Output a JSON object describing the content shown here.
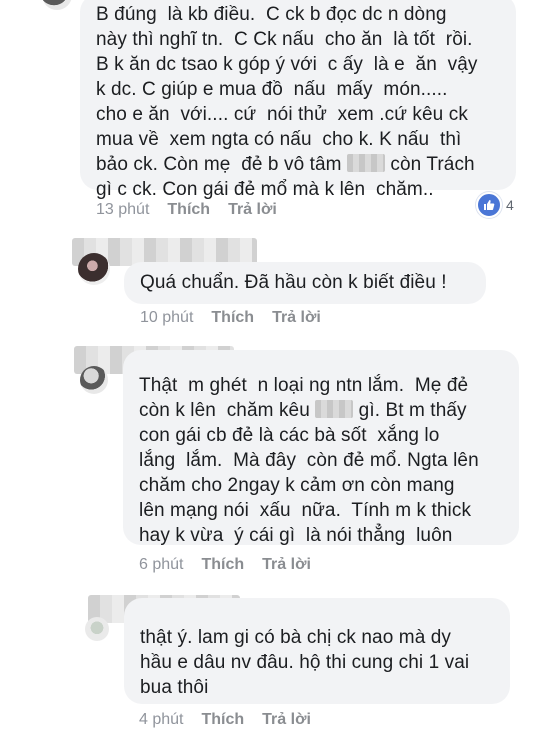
{
  "comments": [
    {
      "lines": [
        "B đúng  là kb điều.  C ck b đọc dc n dòng",
        "này thì nghĩ tn.  C Ck nấu  cho ăn  là tốt  rồi.",
        "B k ăn dc tsao k góp ý với  c ấy  là e  ăn  vậy",
        "k dc. C giúp e mua đồ  nấu  mấy  món.....",
        "cho e ăn  với.... cứ  nói thử  xem .cứ kêu ck",
        "mua về  xem ngta có nấu  cho k. K nấu  thì",
        "bảo ck. Còn mẹ  đẻ b vô tâm",
        "gì c ck. Con gái đẻ mổ mà k lên  chăm.."
      ],
      "line7_after_mask": "còn Trách",
      "time": "13 phút",
      "like": "Thích",
      "reply": "Trả lời",
      "reaction_count": "4"
    },
    {
      "lines": [
        "Quá chuẩn. Đã hầu còn k biết điều !"
      ],
      "time": "10 phút",
      "like": "Thích",
      "reply": "Trả lời"
    },
    {
      "line1": "Thật  m ghét  n loại ng ntn lắm.  Mẹ đẻ",
      "line2_before": "còn k lên  chăm kêu",
      "line2_after": "gì. Bt m thấy",
      "rest": [
        "con gái cb đẻ là các bà sốt  xắng lo",
        "lắng  lắm.  Mà đây  còn đẻ mổ. Ngta lên",
        "chăm cho 2ngay k cảm ơn còn mang",
        "lên mạng nói  xấu  nữa.  Tính m k thick",
        "hay k vừa  ý cái gì  là nói thẳng  luôn"
      ],
      "time": "6 phút",
      "like": "Thích",
      "reply": "Trả lời"
    },
    {
      "lines": [
        "thật ý. lam gi có bà chị ck nao mà dy",
        "hầu e dâu nv đâu. hộ thi cung chi 1 vai",
        "bua thôi"
      ],
      "time": "4 phút",
      "like": "Thích",
      "reply": "Trả lời"
    }
  ],
  "colors": {
    "bubble": "#f2f3f5",
    "meta": "#90949c",
    "like_blue": "#4a76d6"
  },
  "icons": {
    "reaction": "thumbs-up-icon"
  }
}
